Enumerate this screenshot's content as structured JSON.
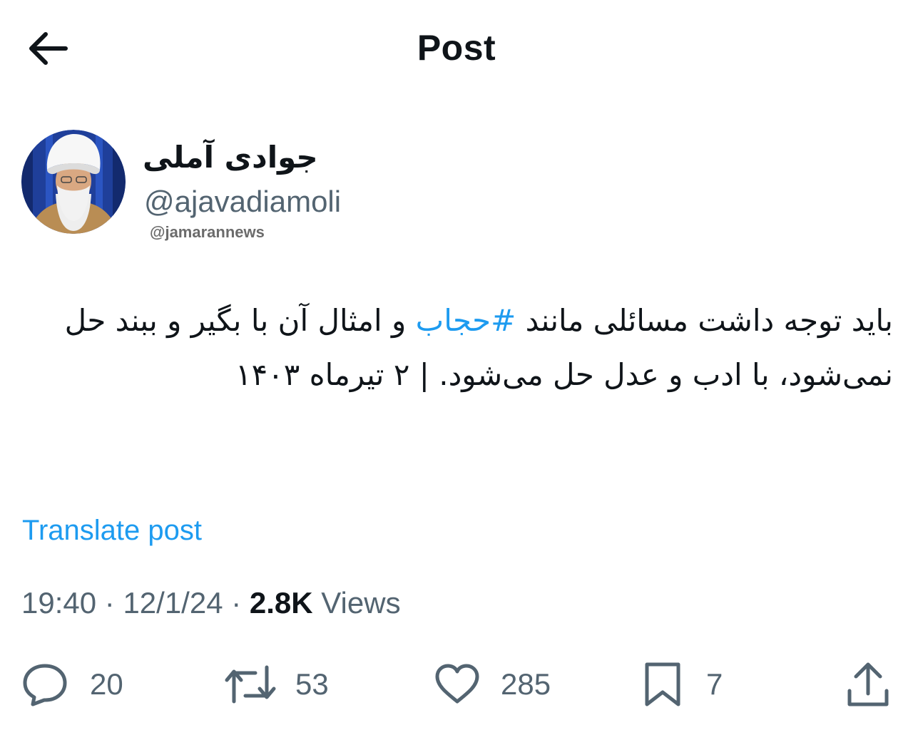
{
  "header": {
    "title": "Post",
    "back_icon": "arrow-left-icon"
  },
  "author": {
    "display_name": "جوادی آملی",
    "handle": "@ajavadiamoli",
    "watermark": "@jamarannews"
  },
  "tweet": {
    "text_before": "باید توجه داشت مسائلی مانند ",
    "hashtag": "#حجاب",
    "text_after": " و امثال آن با بگیر و ببند حل نمی‌شود، با ادب و عدل حل می‌شود. | ۲ تیرماه ۱۴۰۳"
  },
  "translate_label": "Translate post",
  "meta": {
    "time": "19:40",
    "sep1": " · ",
    "date": "12/1/24",
    "sep2": " · ",
    "views_count": "2.8K",
    "views_label": " Views"
  },
  "actions": {
    "replies": "20",
    "reposts": "53",
    "likes": "285",
    "bookmarks": "7"
  },
  "colors": {
    "accent": "#1d9bf0",
    "text": "#0f1419",
    "muted": "#536471"
  }
}
